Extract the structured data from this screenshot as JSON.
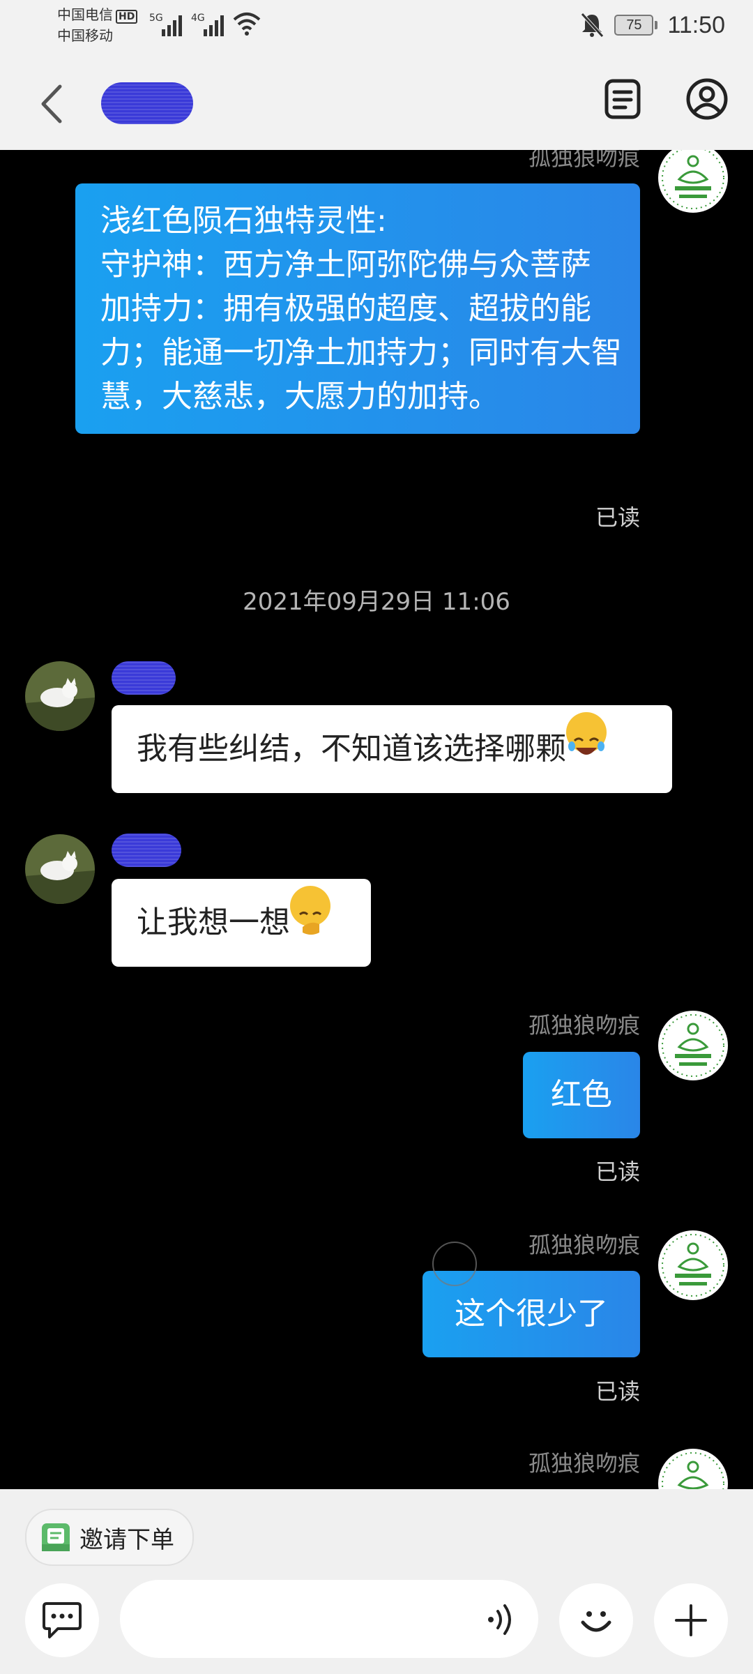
{
  "status_bar": {
    "carrier1": "中国电信",
    "carrier1_badge": "HD",
    "carrier2": "中国移动",
    "net1": "5G",
    "net2": "4G",
    "battery": "75",
    "time": "11:50"
  },
  "chat": {
    "messages": [
      {
        "sender": "孤独狼吻痕",
        "text": "浅红色陨石独特灵性:\n守护神：西方净土阿弥陀佛与众菩萨 加持力：拥有极强的超度、超拔的能力；能通一切净土加持力；同时有大智慧，大慈悲，大愿力的加持。",
        "status": "已读"
      }
    ],
    "timestamp": "2021年09月29日 11:06",
    "incoming": [
      {
        "text": "我有些纠结，不知道该选择哪颗"
      },
      {
        "text": "让我想一想"
      }
    ],
    "outgoing": [
      {
        "sender": "孤独狼吻痕",
        "text": "红色",
        "status": "已读"
      },
      {
        "sender": "孤独狼吻痕",
        "text": "这个很少了",
        "status": "已读"
      },
      {
        "sender": "孤独狼吻痕"
      }
    ]
  },
  "bottom": {
    "chip_label": "邀请下单"
  },
  "icons": {
    "back": "chevron-left-icon",
    "order_list": "order-list-icon",
    "profile": "user-profile-icon",
    "message": "chat-bubble-icon",
    "voice": "voice-wave-icon",
    "emoji": "smiley-icon",
    "add": "plus-icon"
  },
  "colors": {
    "accent_bubble": "#1d9af0",
    "background": "#000000",
    "panel": "#f0f0f0"
  }
}
